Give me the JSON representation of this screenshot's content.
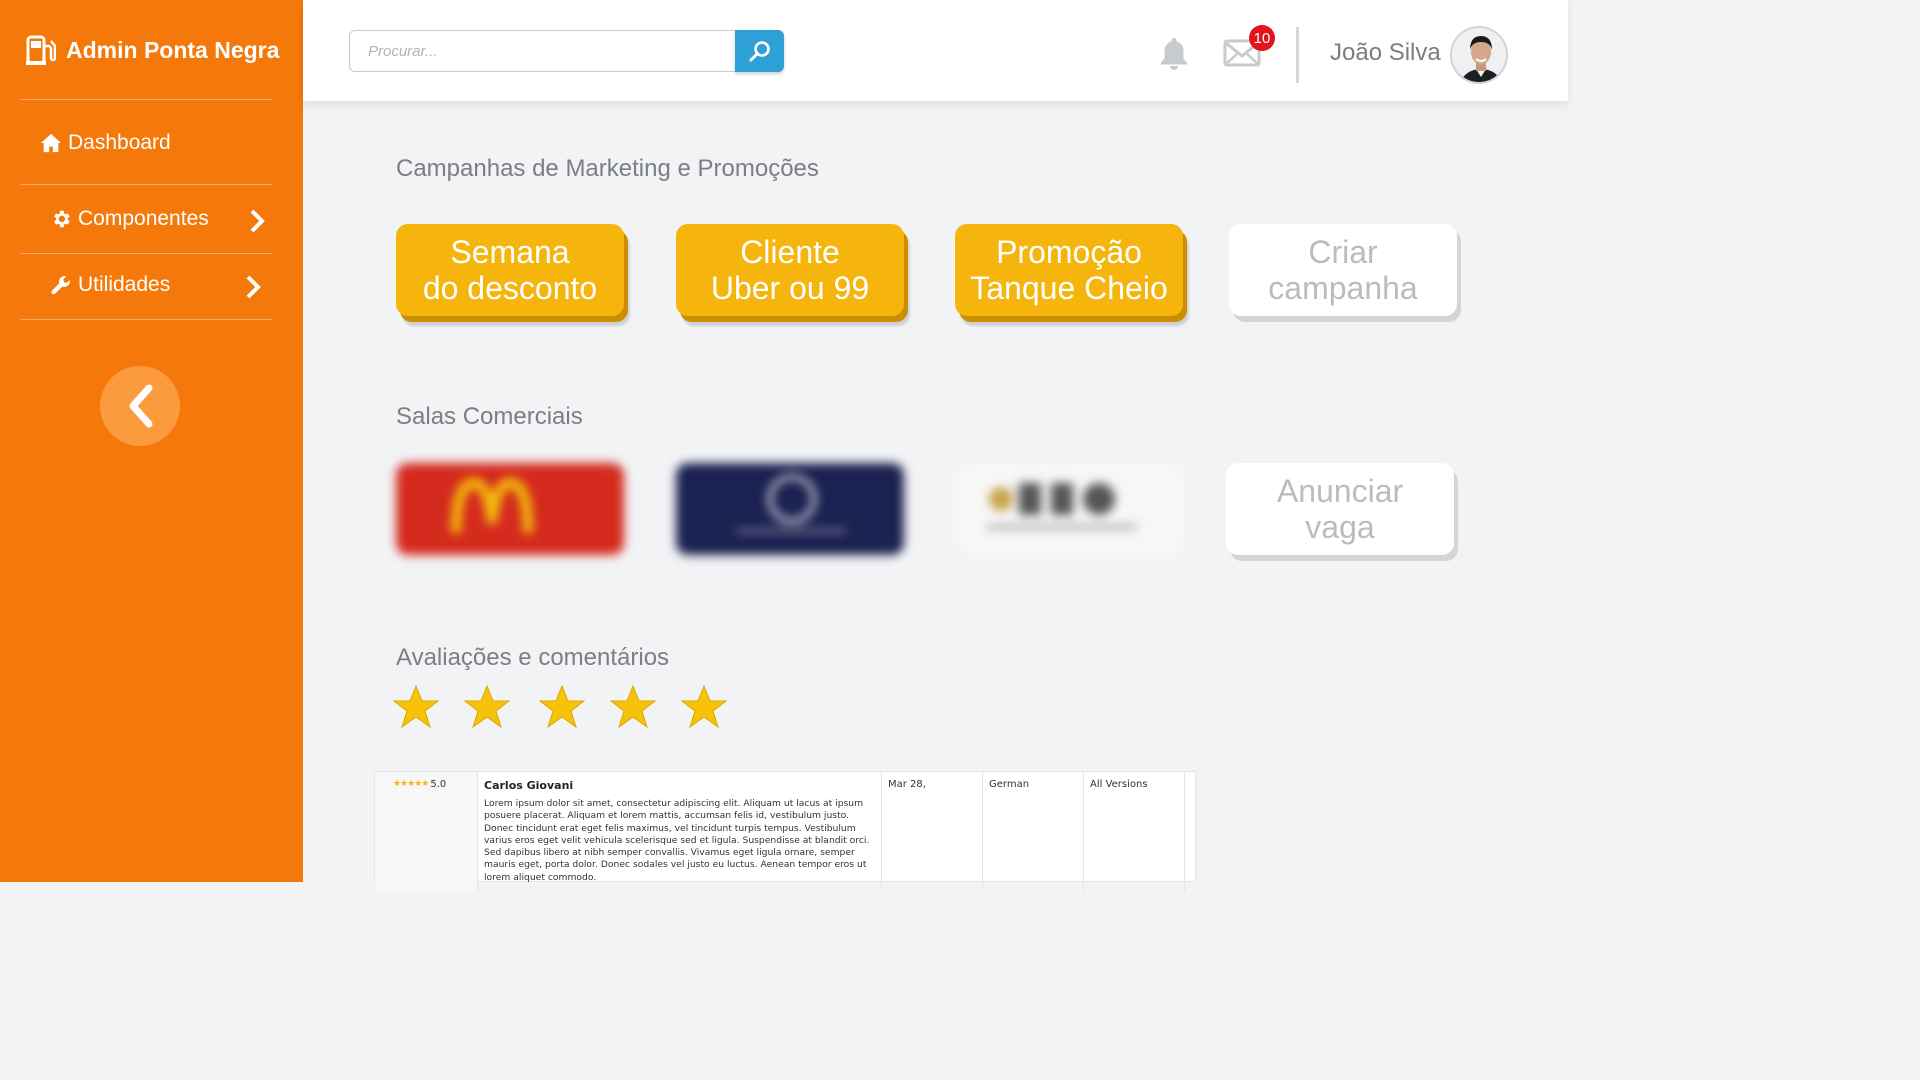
{
  "sidebar": {
    "brand": "Admin Ponta Negra",
    "items": [
      {
        "label": "Dashboard",
        "icon": "home-icon"
      },
      {
        "label": "Componentes",
        "icon": "gear-icon"
      },
      {
        "label": "Utilidades",
        "icon": "wrench-icon"
      }
    ]
  },
  "header": {
    "search_placeholder": "Procurar...",
    "mail_badge": "10",
    "username": "João Silva"
  },
  "campaigns": {
    "title": "Campanhas de Marketing e Promoções",
    "tiles": [
      {
        "line1": "Semana",
        "line2": "do desconto"
      },
      {
        "line1": "Cliente",
        "line2": "Uber ou 99"
      },
      {
        "line1": "Promoção",
        "line2": "Tanque Cheio"
      },
      {
        "line1": "Criar",
        "line2": "campanha"
      }
    ]
  },
  "rooms": {
    "title": "Salas Comerciais",
    "logos": [
      "mcdonalds-logo",
      "navy-brand-logo",
      "dbo-logo"
    ],
    "add_tile": {
      "line1": "Anunciar",
      "line2": "vaga"
    }
  },
  "reviews": {
    "title": "Avaliações e comentários",
    "rating_shown": 5,
    "rating_max": 5,
    "rows": [
      {
        "stars": "★★★★★",
        "score": "5.0",
        "name": "Carlos Giovani",
        "text": "Lorem ipsum dolor sit amet, consectetur adipiscing elit. Aliquam ut lacus at ipsum posuere placerat. Aliquam et lorem mattis, accumsan felis id, vestibulum justo. Donec tincidunt erat eget felis maximus, vel tincidunt turpis tempus. Vestibulum varius eros eget velit vehicula scelerisque sed et ligula. Suspendisse at blandit orci. Sed dapibus libero at nibh semper convallis. Vivamus eget ligula ornare, semper mauris eget, porta dolor. Donec sodales vel justo eu luctus. Aenean tempor eros ut lorem aliquet commodo.",
        "date": "Mar 28,",
        "language": "German",
        "version": "All Versions"
      }
    ]
  },
  "colors": {
    "sidebar": "#f5780b",
    "tile_yellow": "#f5b50d",
    "search_button": "#2f9fd8",
    "badge": "#e3121b"
  }
}
